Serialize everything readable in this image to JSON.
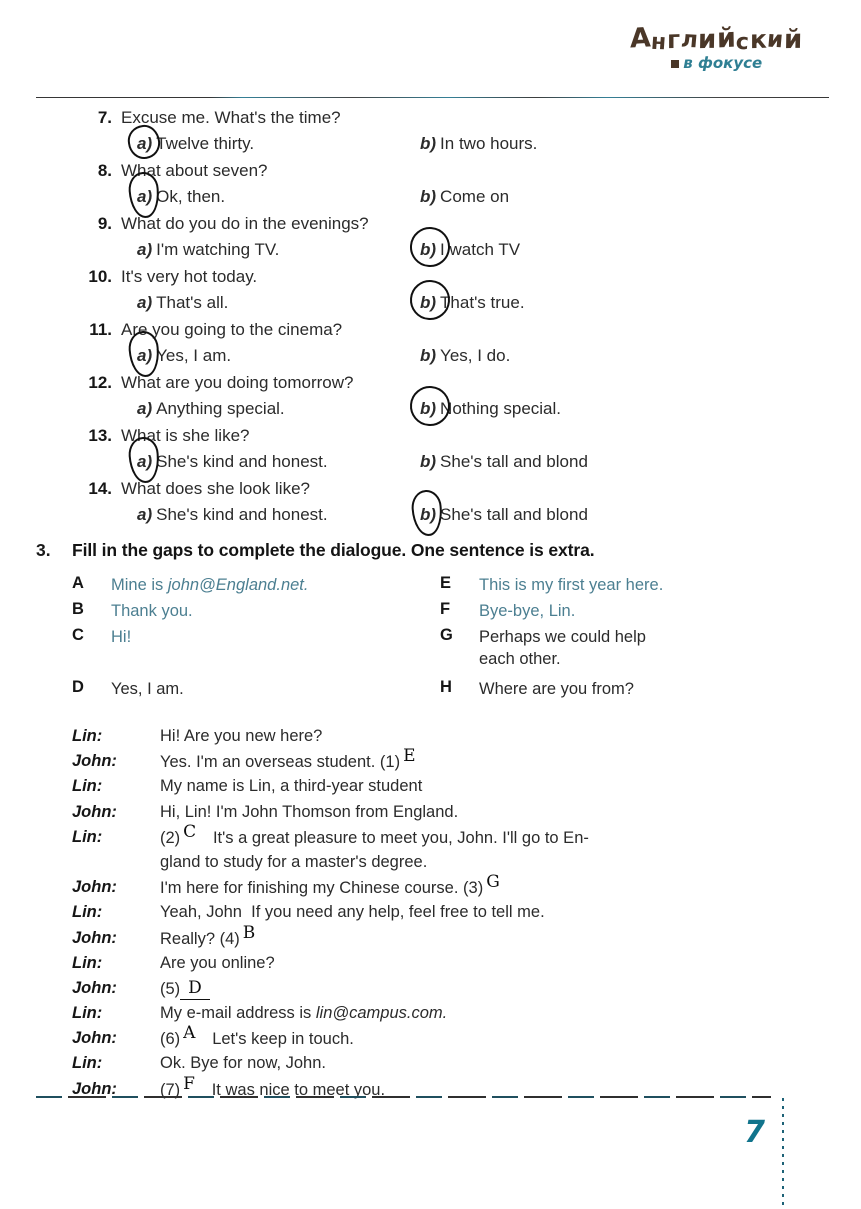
{
  "logo": {
    "main": "Английский",
    "sub": "в фокусе"
  },
  "page_number": "7",
  "multiple_choice": [
    {
      "number": "7.",
      "question": "Excuse me. What's the time?",
      "option_a": "Twelve thirty.",
      "option_b": "In two hours.",
      "letter_a": "a)",
      "letter_b": "b)",
      "circled": "a"
    },
    {
      "number": "8.",
      "question": "What about seven?",
      "option_a": "Ok, then.",
      "option_b": "Come on",
      "letter_a": "a)",
      "letter_b": "b)",
      "circled": "a"
    },
    {
      "number": "9.",
      "question": "What do you do in the evenings?",
      "option_a": "I'm watching TV.",
      "option_b": "I watch TV",
      "letter_a": "a)",
      "letter_b": "b)",
      "circled": "b"
    },
    {
      "number": "10.",
      "question": "It's very hot today.",
      "option_a": "That's all.",
      "option_b": "That's true.",
      "letter_a": "a)",
      "letter_b": "b)",
      "circled": "b"
    },
    {
      "number": "11.",
      "question": "Are you going to the cinema?",
      "option_a": "Yes, I am.",
      "option_b": "Yes, I do.",
      "letter_a": "a)",
      "letter_b": "b)",
      "circled": "a"
    },
    {
      "number": "12.",
      "question": "What are you doing tomorrow?",
      "option_a": "Anything special.",
      "option_b": "Nothing special.",
      "letter_a": "a)",
      "letter_b": "b)",
      "circled": "b"
    },
    {
      "number": "13.",
      "question": "What is she like?",
      "option_a": "She's kind and honest.",
      "option_b": "She's tall and blond",
      "letter_a": "a)",
      "letter_b": "b)",
      "circled": "a"
    },
    {
      "number": "14.",
      "question": "What does she look like?",
      "option_a": "She's kind and honest.",
      "option_b": "She's tall and blond",
      "letter_a": "a)",
      "letter_b": "b)",
      "circled": "b"
    }
  ],
  "exercise3": {
    "number": "3.",
    "title": "Fill in the gaps to complete the dialogue. One sentence is extra.",
    "bank": [
      {
        "letter": "A",
        "text": "Mine is john@England.net."
      },
      {
        "letter": "B",
        "text": "Thank you."
      },
      {
        "letter": "C",
        "text": "Hi!"
      },
      {
        "letter": "D",
        "text": "Yes, I am."
      },
      {
        "letter": "E",
        "text": "This is my first year here."
      },
      {
        "letter": "F",
        "text": "Bye-bye, Lin."
      },
      {
        "letter": "G",
        "text": "Perhaps we could help\neach other."
      },
      {
        "letter": "H",
        "text": "Where are you from?"
      }
    ],
    "dialogue": [
      {
        "speaker": "Lin:",
        "text": "Hi! Are you new here?"
      },
      {
        "speaker": "John:",
        "text": "Yes. I'm an overseas student. (1)",
        "answer": "E"
      },
      {
        "speaker": "Lin:",
        "text": "My name is Lin, a third-year student"
      },
      {
        "speaker": "John:",
        "text": "Hi, Lin! I'm John Thomson from England."
      },
      {
        "speaker": "Lin:",
        "text": "(2)",
        "answer": "C",
        "text_after": "It's a great pleasure to meet you, John. I'll go to En-"
      },
      {
        "speaker": "",
        "text": "gland to study for a master's degree."
      },
      {
        "speaker": "John:",
        "text": "I'm here for finishing my Chinese course. (3)",
        "answer": "G"
      },
      {
        "speaker": "Lin:",
        "text": "Yeah, John  If you need any help, feel free to tell me."
      },
      {
        "speaker": "John:",
        "text": "Really? (4)",
        "answer": "B"
      },
      {
        "speaker": "Lin:",
        "text": "Are you online?"
      },
      {
        "speaker": "John:",
        "text": "(5)",
        "answer": "D",
        "answer_style": "underlined"
      },
      {
        "speaker": "Lin:",
        "text": "My e-mail address is lin@campus.com."
      },
      {
        "speaker": "John:",
        "text": "(6)",
        "answer": "A",
        "text_after": "Let's keep in touch."
      },
      {
        "speaker": "Lin:",
        "text": "Ok. Bye for now, John."
      },
      {
        "speaker": "John:",
        "text": "(7)",
        "answer": "F",
        "text_after": "It was nice to meet you."
      }
    ]
  }
}
